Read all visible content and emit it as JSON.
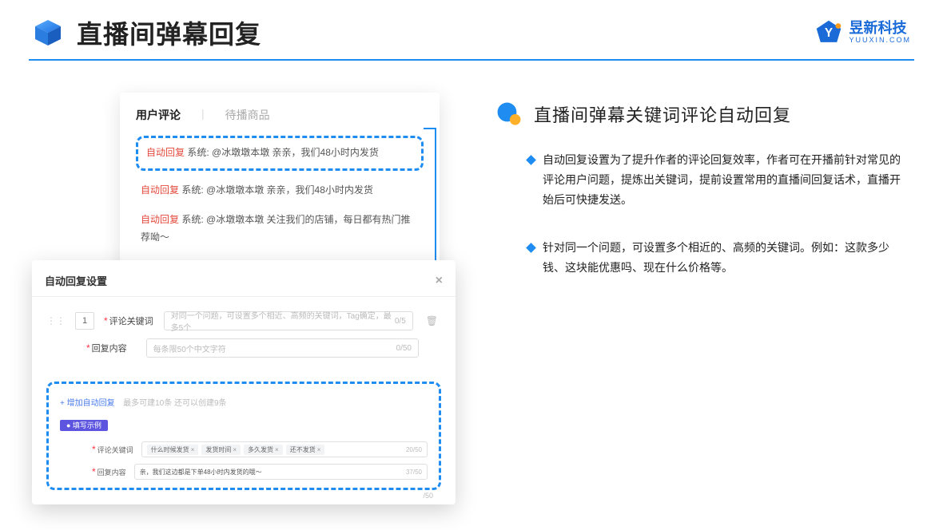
{
  "header": {
    "title": "直播间弹幕回复",
    "brand_cn": "昱新科技",
    "brand_en": "YUUXIN.COM"
  },
  "comments_card": {
    "tab_active": "用户评论",
    "tab_inactive": "待播商品",
    "items": [
      {
        "tag": "自动回复",
        "text": "系统: @冰墩墩本墩 亲亲，我们48小时内发货",
        "highlight": true
      },
      {
        "tag": "自动回复",
        "text": "系统: @冰墩墩本墩 亲亲，我们48小时内发货",
        "highlight": false
      },
      {
        "tag": "自动回复",
        "text": "系统: @冰墩墩本墩 关注我们的店铺，每日都有热门推荐呦～",
        "highlight": false
      }
    ]
  },
  "settings_card": {
    "title": "自动回复设置",
    "idx": "1",
    "keyword_label": "评论关键词",
    "keyword_placeholder": "对同一个问题，可设置多个相近、高频的关键词，Tag确定，最多5个",
    "keyword_counter": "0/5",
    "content_label": "回复内容",
    "content_placeholder": "每条限50个中文字符",
    "content_counter": "0/50",
    "add_link": "+ 增加自动回复",
    "add_hint": "最多可建10条 还可以创建9条",
    "badge": "● 填写示例",
    "ex_kw_label": "评论关键词",
    "chips": [
      "什么时候发货",
      "发货时间",
      "多久发货",
      "还不发货"
    ],
    "ex_kw_counter": "20/50",
    "ex_content_label": "回复内容",
    "ex_content_value": "亲，我们这边都是下单48小时内发货的哦～",
    "ex_content_counter": "37/50",
    "lower_counter": "/50"
  },
  "right": {
    "title": "直播间弹幕关键词评论自动回复",
    "bullets": [
      "自动回复设置为了提升作者的评论回复效率，作者可在开播前针对常见的评论用户问题，提炼出关键词，提前设置常用的直播间回复话术，直播开始后可快捷发送。",
      "针对同一个问题，可设置多个相近的、高频的关键词。例如：这款多少钱、这块能优惠吗、现在什么价格等。"
    ]
  }
}
